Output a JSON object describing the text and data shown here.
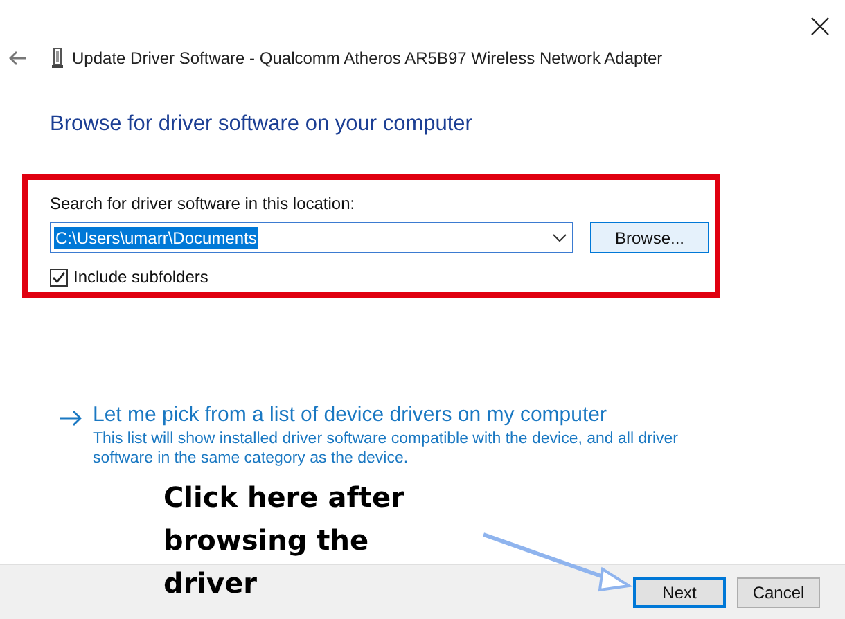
{
  "window": {
    "title": "Update Driver Software - Qualcomm Atheros AR5B97 Wireless Network Adapter"
  },
  "heading": "Browse for driver software on your computer",
  "search_location": {
    "label": "Search for driver software in this location:",
    "value": "C:\\Users\\umarr\\Documents",
    "value_selected": true,
    "browse_button": "Browse...",
    "include_subfolders": {
      "label": "Include subfolders",
      "checked": true
    }
  },
  "pick_option": {
    "title": "Let me pick from a list of device drivers on my computer",
    "description": "This list will show installed driver software compatible with the device, and all driver software in the same category as the device."
  },
  "annotation": {
    "lines": [
      "Click here after",
      "browsing the",
      "driver"
    ]
  },
  "buttons": [
    {
      "label": "Next",
      "selected": true
    },
    {
      "label": "Cancel",
      "selected": false
    }
  ]
}
